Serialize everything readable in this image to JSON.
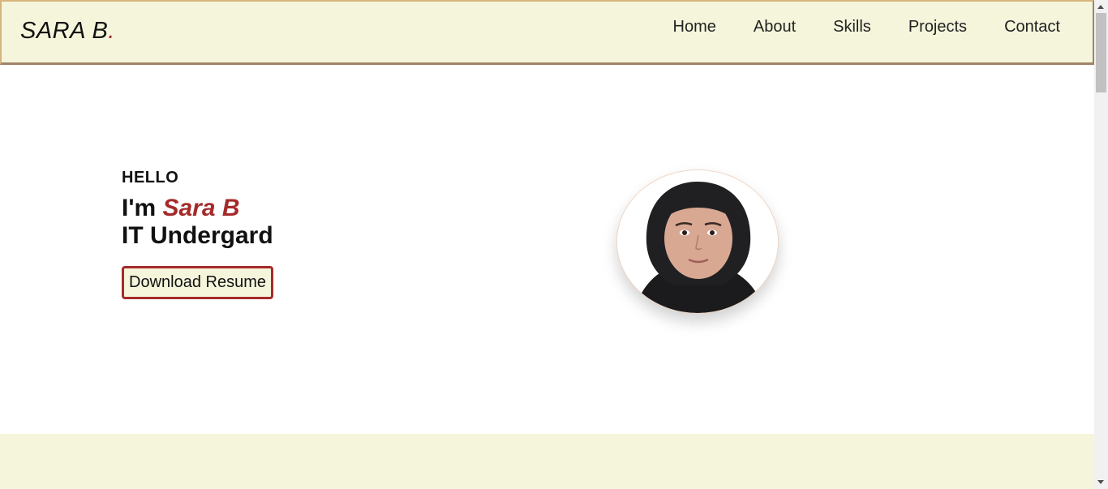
{
  "brand": {
    "name": "SARA B",
    "dot": ".",
    "accent_color": "#a52a2a",
    "nav_bg": "#f5f5dc"
  },
  "nav": {
    "items": [
      {
        "label": "Home"
      },
      {
        "label": "About"
      },
      {
        "label": "Skills"
      },
      {
        "label": "Projects"
      },
      {
        "label": "Contact"
      }
    ]
  },
  "hero": {
    "greeting": "HELLO",
    "intro_prefix": "I'm ",
    "name": "Sara B",
    "role": "IT Undergard",
    "resume_button": "Download Resume",
    "photo_icon": "profile-photo"
  }
}
